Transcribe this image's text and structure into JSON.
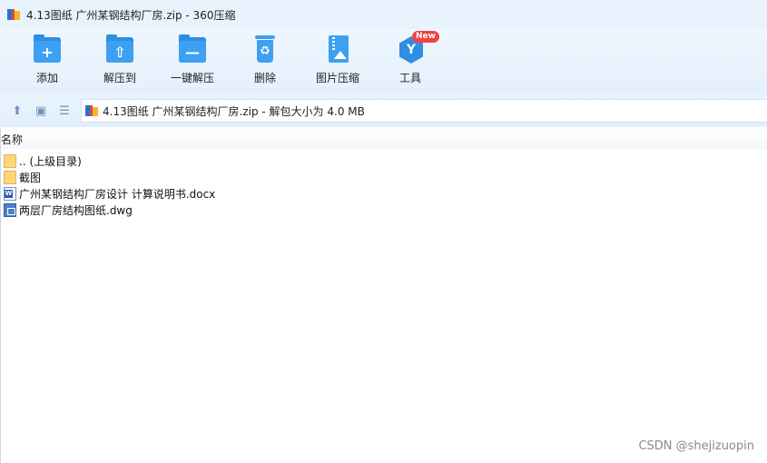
{
  "window": {
    "title": "4.13图纸 广州某钢结构厂房.zip - 360压缩"
  },
  "toolbar": {
    "add": "添加",
    "extract_to": "解压到",
    "one_click_extract": "一键解压",
    "delete": "删除",
    "image_compress": "图片压缩",
    "tools": "工具",
    "new_badge": "New"
  },
  "address": {
    "path": "4.13图纸 广州某钢结构厂房.zip - 解包大小为 4.0 MB"
  },
  "list": {
    "column_name": "名称",
    "items": [
      {
        "name": ".. (上级目录)",
        "icon": "folder-icon"
      },
      {
        "name": "截图",
        "icon": "folder-icon"
      },
      {
        "name": "广州某钢结构厂房设计 计算说明书.docx",
        "icon": "word-doc-icon"
      },
      {
        "name": "两层厂房结构图纸.dwg",
        "icon": "dwg-file-icon"
      }
    ]
  },
  "watermark": "CSDN @shejizuopin",
  "colors": {
    "accent": "#2f8de4",
    "toolbar_bg": "#e9f3fd",
    "badge": "#f04343"
  }
}
